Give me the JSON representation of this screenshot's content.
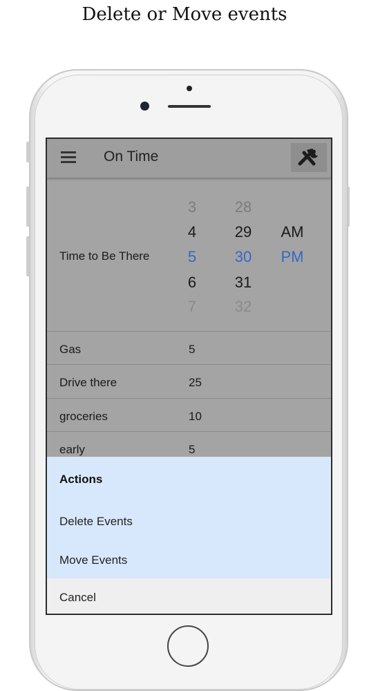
{
  "caption": "Delete or Move events",
  "app": {
    "title": "On Time",
    "menu_icon": "hamburger-menu-icon",
    "tools_icon": "hammer-wrench-icon"
  },
  "time_picker": {
    "label": "Time to Be There",
    "hours": [
      "3",
      "4",
      "5",
      "6",
      "7"
    ],
    "minutes": [
      "28",
      "29",
      "30",
      "31",
      "32"
    ],
    "period": [
      "AM",
      "PM"
    ],
    "selected": {
      "hour": "5",
      "minute": "30",
      "period": "PM"
    },
    "accent_color": "#3567c4"
  },
  "events": [
    {
      "name": "Gas",
      "minutes": "5"
    },
    {
      "name": "Drive there",
      "minutes": "25"
    },
    {
      "name": "groceries",
      "minutes": "10"
    },
    {
      "name": "early",
      "minutes": "5"
    }
  ],
  "action_sheet": {
    "title": "Actions",
    "items": [
      "Delete Events",
      "Move Events"
    ],
    "cancel": "Cancel",
    "background": "#d8e8fc"
  }
}
